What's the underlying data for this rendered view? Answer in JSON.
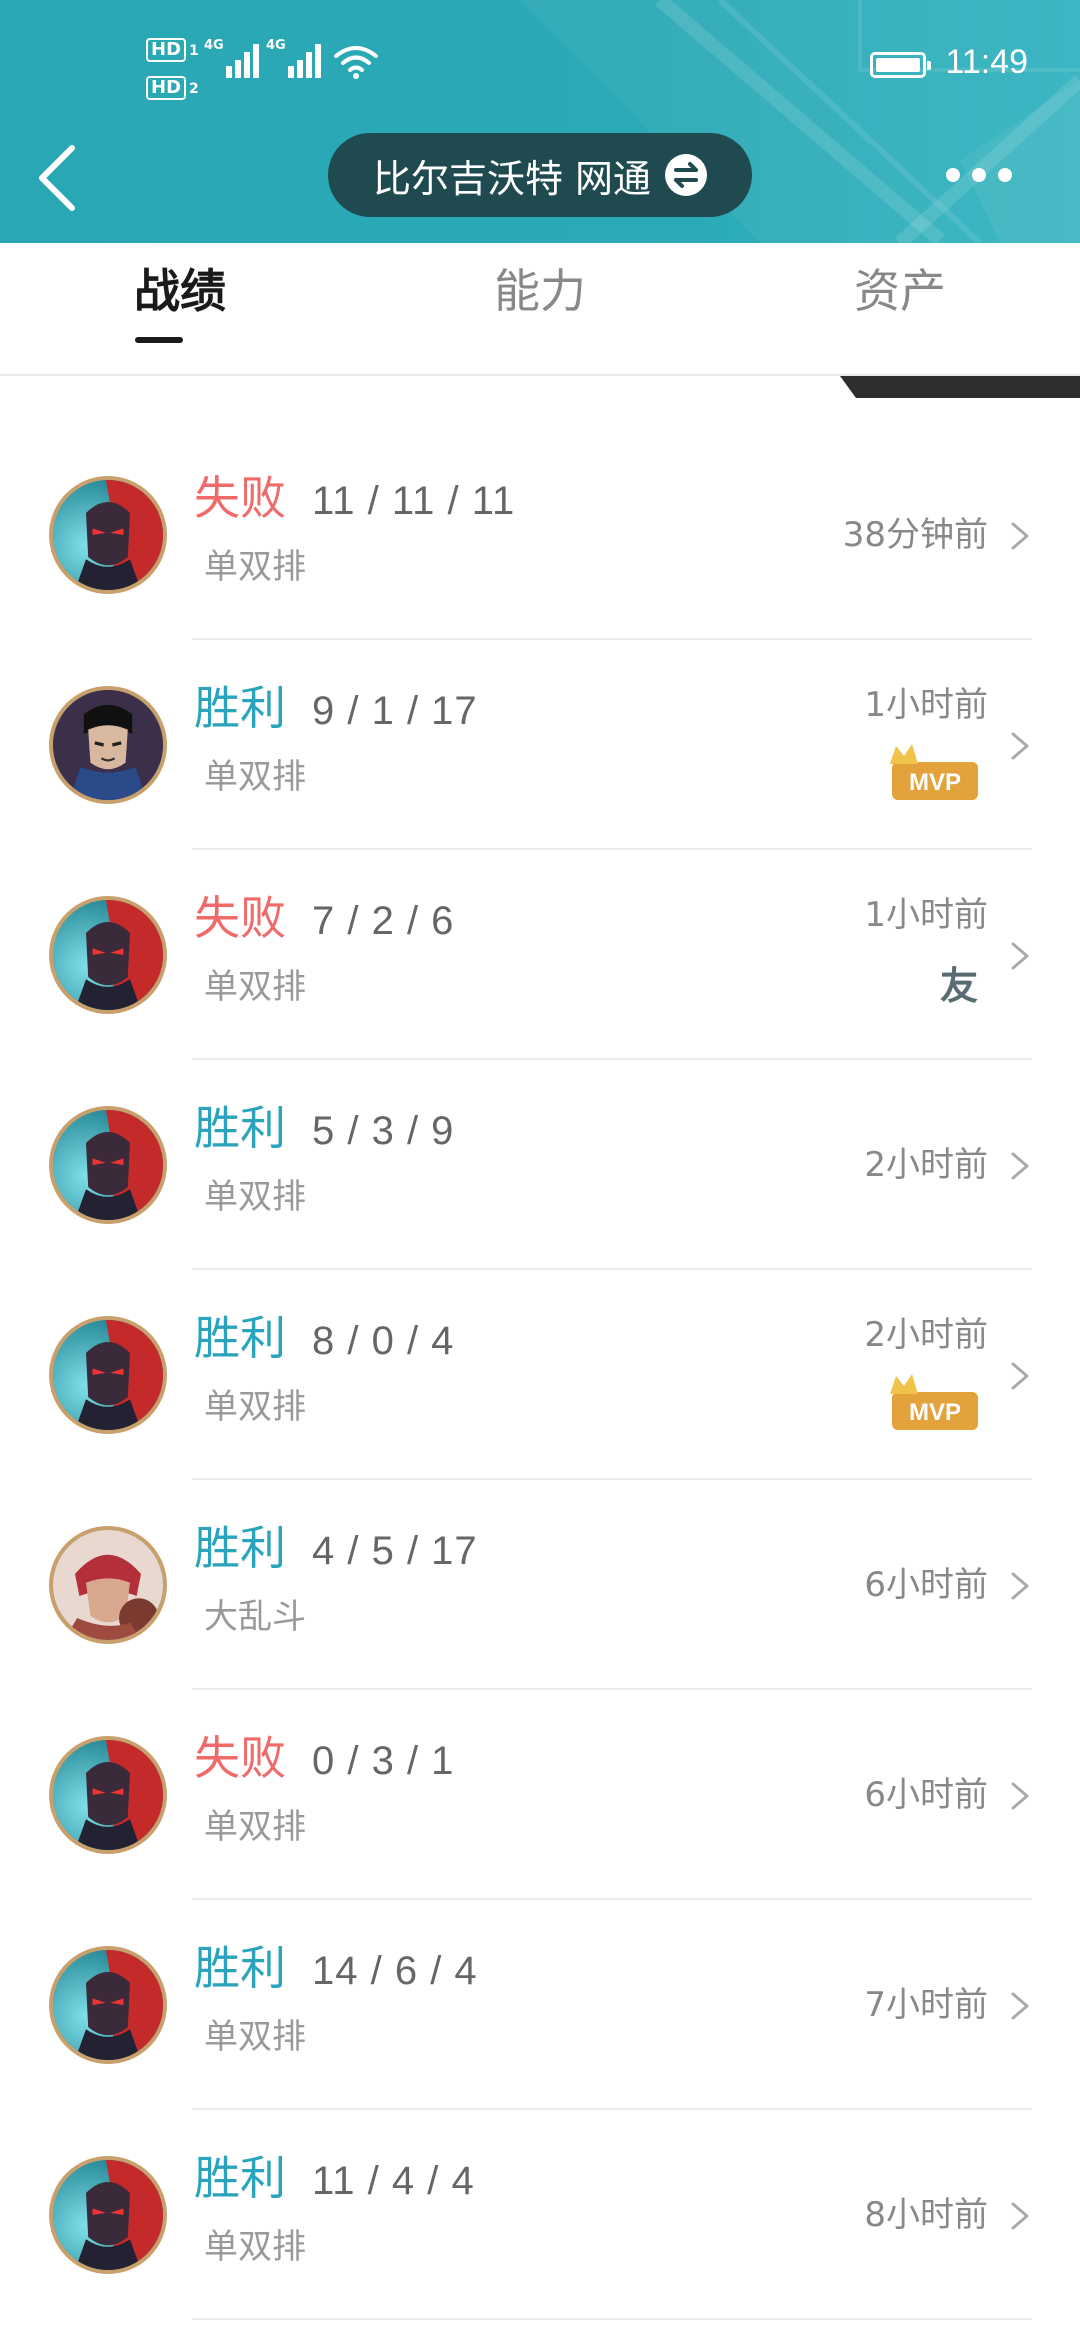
{
  "status_bar": {
    "sim1_label": "HD",
    "sim1_index": "1",
    "sim2_label": "HD",
    "sim2_index": "2",
    "network1": "4G",
    "network2": "4G",
    "time": "11:49"
  },
  "nav": {
    "server_name": "比尔吉沃特 网通"
  },
  "tabs": [
    {
      "label": "战绩",
      "active": true
    },
    {
      "label": "能力",
      "active": false
    },
    {
      "label": "资产",
      "active": false
    }
  ],
  "matches": [
    {
      "result": "失败",
      "outcome": "lose",
      "kda": "11 / 11 / 11",
      "mode": "单双排",
      "time_ago": "38分钟前",
      "badge": "",
      "hero_icon": "red-blue-warrior-avatar"
    },
    {
      "result": "胜利",
      "outcome": "win",
      "kda": "9 / 1 / 17",
      "mode": "单双排",
      "time_ago": "1小时前",
      "badge": "MVP",
      "hero_icon": "dark-haired-swordsman-avatar"
    },
    {
      "result": "失败",
      "outcome": "lose",
      "kda": "7 / 2 / 6",
      "mode": "单双排",
      "time_ago": "1小时前",
      "badge": "友",
      "hero_icon": "red-blue-warrior-avatar"
    },
    {
      "result": "胜利",
      "outcome": "win",
      "kda": "5 / 3 / 9",
      "mode": "单双排",
      "time_ago": "2小时前",
      "badge": "",
      "hero_icon": "red-blue-warrior-avatar"
    },
    {
      "result": "胜利",
      "outcome": "win",
      "kda": "8 / 0 / 4",
      "mode": "单双排",
      "time_ago": "2小时前",
      "badge": "MVP",
      "hero_icon": "red-blue-warrior-avatar"
    },
    {
      "result": "胜利",
      "outcome": "win",
      "kda": "4 / 5 / 17",
      "mode": "大乱斗",
      "time_ago": "6小时前",
      "badge": "",
      "hero_icon": "red-haired-brawler-avatar"
    },
    {
      "result": "失败",
      "outcome": "lose",
      "kda": "0 / 3 / 1",
      "mode": "单双排",
      "time_ago": "6小时前",
      "badge": "",
      "hero_icon": "red-blue-warrior-avatar"
    },
    {
      "result": "胜利",
      "outcome": "win",
      "kda": "14 / 6 / 4",
      "mode": "单双排",
      "time_ago": "7小时前",
      "badge": "",
      "hero_icon": "red-blue-warrior-avatar"
    },
    {
      "result": "胜利",
      "outcome": "win",
      "kda": "11 / 4 / 4",
      "mode": "单双排",
      "time_ago": "8小时前",
      "badge": "",
      "hero_icon": "red-blue-warrior-avatar"
    }
  ],
  "colors": {
    "header_teal": "#2aa7b4",
    "server_pill": "#1f4a50",
    "lose_red": "#f06a6a",
    "win_teal": "#2aa3bd",
    "mvp_gold": "#e3a23c"
  }
}
